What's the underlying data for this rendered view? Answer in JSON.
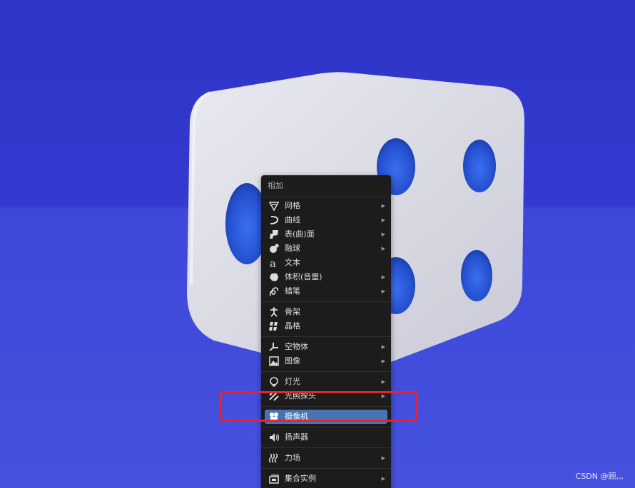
{
  "menu": {
    "title": "相加",
    "groups": [
      [
        {
          "label": "网格",
          "icon": "mesh-icon",
          "submenu": true
        },
        {
          "label": "曲线",
          "icon": "curve-icon",
          "submenu": true
        },
        {
          "label": "表(曲)面",
          "icon": "surface-icon",
          "submenu": true
        },
        {
          "label": "融球",
          "icon": "metaball-icon",
          "submenu": true
        },
        {
          "label": "文本",
          "icon": "text-icon",
          "submenu": false
        },
        {
          "label": "体积(音量)",
          "icon": "volume-icon",
          "submenu": true
        },
        {
          "label": "蜡笔",
          "icon": "grease-pencil-icon",
          "submenu": true
        }
      ],
      [
        {
          "label": "骨架",
          "icon": "armature-icon",
          "submenu": false
        },
        {
          "label": "晶格",
          "icon": "lattice-icon",
          "submenu": false
        }
      ],
      [
        {
          "label": "空物体",
          "icon": "empty-icon",
          "submenu": true
        },
        {
          "label": "图像",
          "icon": "image-icon",
          "submenu": true
        }
      ],
      [
        {
          "label": "灯光",
          "icon": "light-icon",
          "submenu": true
        },
        {
          "label": "光照探头",
          "icon": "light-probe-icon",
          "submenu": true
        }
      ],
      [
        {
          "label": "摄像机",
          "icon": "camera-icon",
          "submenu": false,
          "highlighted": true
        }
      ],
      [
        {
          "label": "扬声器",
          "icon": "speaker-icon",
          "submenu": false
        }
      ],
      [
        {
          "label": "力场",
          "icon": "force-field-icon",
          "submenu": true
        }
      ],
      [
        {
          "label": "集合实例",
          "icon": "collection-instance-icon",
          "submenu": true
        }
      ]
    ],
    "arrow_glyph": "▶"
  },
  "watermark": "CSDN @顾,,,",
  "colors": {
    "menu_bg": "#1c1c1c",
    "highlight": "#4772b3",
    "annotation": "#e8232f",
    "background": "#3b42d4",
    "dice": "#d8d9e3"
  }
}
